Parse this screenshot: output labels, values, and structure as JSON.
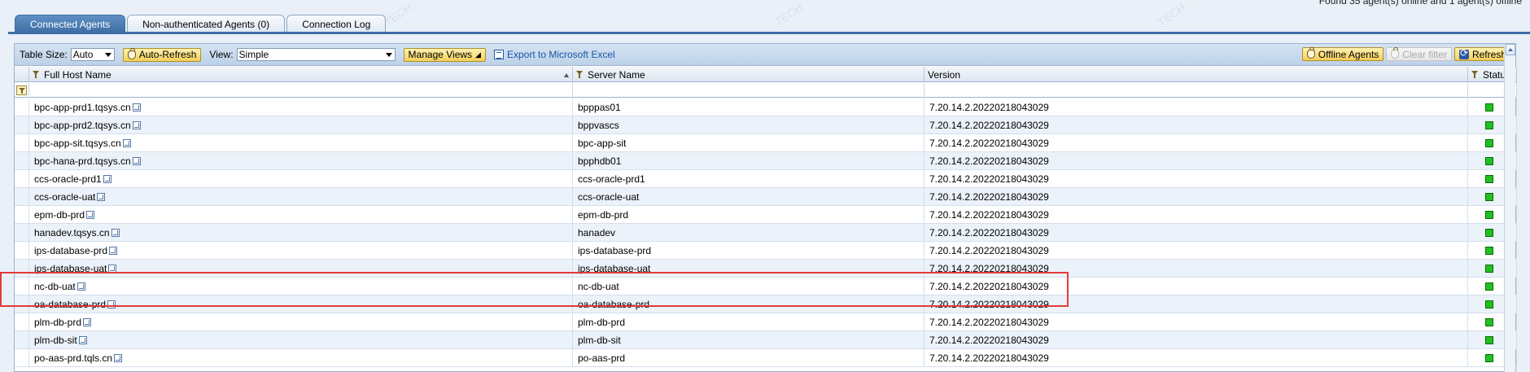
{
  "top_status": "Found 35 agent(s) online and 1 agent(s) offline",
  "tabs": [
    {
      "label": "Connected Agents",
      "active": true
    },
    {
      "label": "Non-authenticated Agents (0)",
      "active": false
    },
    {
      "label": "Connection Log",
      "active": false
    }
  ],
  "toolbar": {
    "table_size_label": "Table Size:",
    "table_size_value": "Auto",
    "auto_refresh": "Auto-Refresh",
    "view_label": "View:",
    "view_value": "Simple",
    "manage_views": "Manage Views",
    "export": "Export to Microsoft Excel",
    "offline_agents": "Offline Agents",
    "clear_filter": "Clear filter",
    "refresh": "Refresh"
  },
  "columns": {
    "host": "Full Host Name",
    "server": "Server Name",
    "version": "Version",
    "status": "Status"
  },
  "rows": [
    {
      "host": "bpc-app-prd1.tqsys.cn",
      "server": "bpppas01",
      "version": "7.20.14.2.20220218043029",
      "status": "online"
    },
    {
      "host": "bpc-app-prd2.tqsys.cn",
      "server": "bppvascs",
      "version": "7.20.14.2.20220218043029",
      "status": "online"
    },
    {
      "host": "bpc-app-sit.tqsys.cn",
      "server": "bpc-app-sit",
      "version": "7.20.14.2.20220218043029",
      "status": "online"
    },
    {
      "host": "bpc-hana-prd.tqsys.cn",
      "server": "bpphdb01",
      "version": "7.20.14.2.20220218043029",
      "status": "online"
    },
    {
      "host": "ccs-oracle-prd1",
      "server": "ccs-oracle-prd1",
      "version": "7.20.14.2.20220218043029",
      "status": "online"
    },
    {
      "host": "ccs-oracle-uat",
      "server": "ccs-oracle-uat",
      "version": "7.20.14.2.20220218043029",
      "status": "online"
    },
    {
      "host": "epm-db-prd",
      "server": "epm-db-prd",
      "version": "7.20.14.2.20220218043029",
      "status": "online"
    },
    {
      "host": "hanadev.tqsys.cn",
      "server": "hanadev",
      "version": "7.20.14.2.20220218043029",
      "status": "online"
    },
    {
      "host": "ips-database-prd",
      "server": "ips-database-prd",
      "version": "7.20.14.2.20220218043029",
      "status": "online"
    },
    {
      "host": "ips-database-uat",
      "server": "ips-database-uat",
      "version": "7.20.14.2.20220218043029",
      "status": "online"
    },
    {
      "host": "nc-db-uat",
      "server": "nc-db-uat",
      "version": "7.20.14.2.20220218043029",
      "status": "online"
    },
    {
      "host": "oa-database-prd",
      "server": "oa-database-prd",
      "version": "7.20.14.2.20220218043029",
      "status": "online"
    },
    {
      "host": "plm-db-prd",
      "server": "plm-db-prd",
      "version": "7.20.14.2.20220218043029",
      "status": "online"
    },
    {
      "host": "plm-db-sit",
      "server": "plm-db-sit",
      "version": "7.20.14.2.20220218043029",
      "status": "online"
    },
    {
      "host": "po-aas-prd.tqls.cn",
      "server": "po-aas-prd",
      "version": "7.20.14.2.20220218043029",
      "status": "online"
    }
  ],
  "colors": {
    "tab_active": "#3e6fa6",
    "toolbar_button": "#f3cf57",
    "status_online": "#1fc11f",
    "highlight": "#e33a3a"
  }
}
